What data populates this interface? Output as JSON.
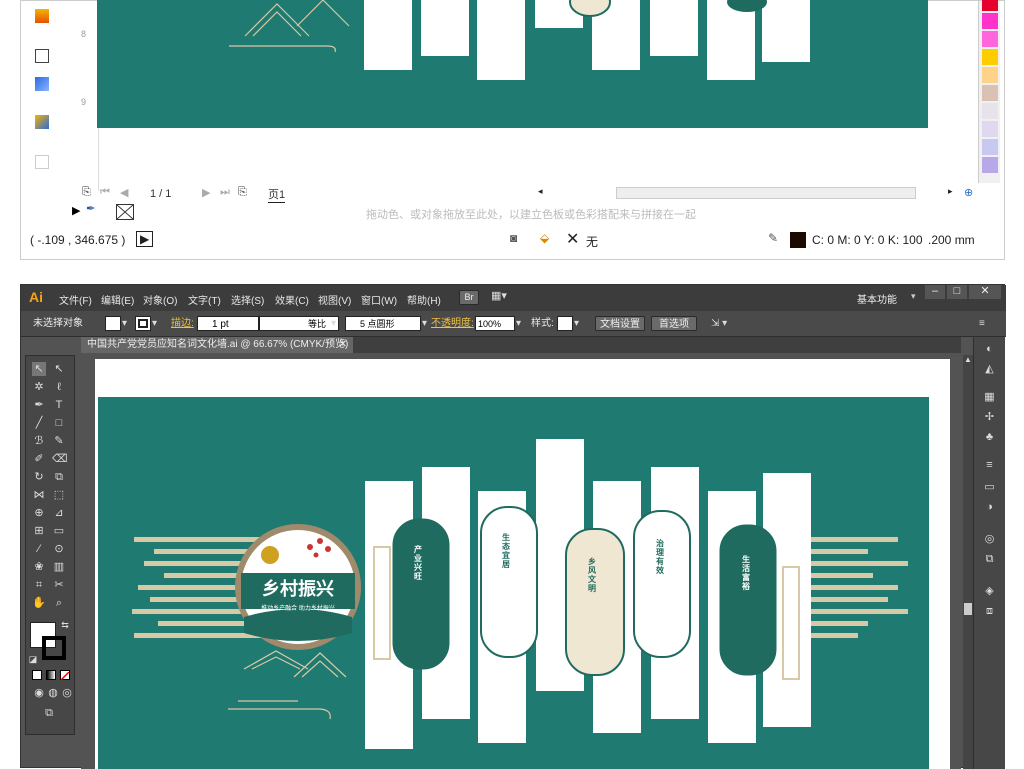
{
  "top_panel": {
    "ruler_marks": [
      "8",
      "9"
    ],
    "page_nav": {
      "page_indicator": "1 / 1",
      "artboard_label": "页1"
    },
    "hint_text": "拖动色、或对象拖放至此处，以建立色板或色彩搭配来与拼接在一起",
    "status": {
      "coords": "( -.109 , 346.675 )",
      "fill_none_label": "无",
      "color_readout": "C: 0 M: 0 Y: 0 K: 100",
      "stroke_width": ".200 mm"
    },
    "swatch_colors": [
      "#e6002d",
      "#ff33cc",
      "#ff66dd",
      "#ffcc00",
      "#ffd28a",
      "#d9c2b3",
      "#e8e3ea",
      "#e0d8f0",
      "#c8c8f0",
      "#b8a8e8",
      "#e6e6e6"
    ]
  },
  "app": {
    "logo": "Ai",
    "menu": [
      "文件(F)",
      "编辑(E)",
      "对象(O)",
      "文字(T)",
      "选择(S)",
      "效果(C)",
      "视图(V)",
      "窗口(W)",
      "帮助(H)"
    ],
    "bridge_btn": "Br",
    "workspace": "基本功能",
    "control_bar": {
      "selection_label": "未选择对象",
      "stroke_label": "描边:",
      "stroke_value": "1 pt",
      "profile_label": "等比",
      "brush_label": "5 点圆形",
      "opacity_label": "不透明度:",
      "opacity_value": "100%",
      "style_label": "样式:",
      "doc_setup_btn": "文档设置",
      "prefs_btn": "首选项"
    },
    "doc_tab": "中国共产党党员应知名词文化墙.ai @ 66.67% (CMYK/预览)",
    "accent": "#1f7a72"
  },
  "artwork": {
    "emblem_title": "乡村振兴",
    "emblem_subtitle": "推动乡产融合 助力乡村振兴",
    "panels": [
      "产业兴旺",
      "生态宜居",
      "乡风文明",
      "治理有效",
      "生活富裕"
    ]
  }
}
